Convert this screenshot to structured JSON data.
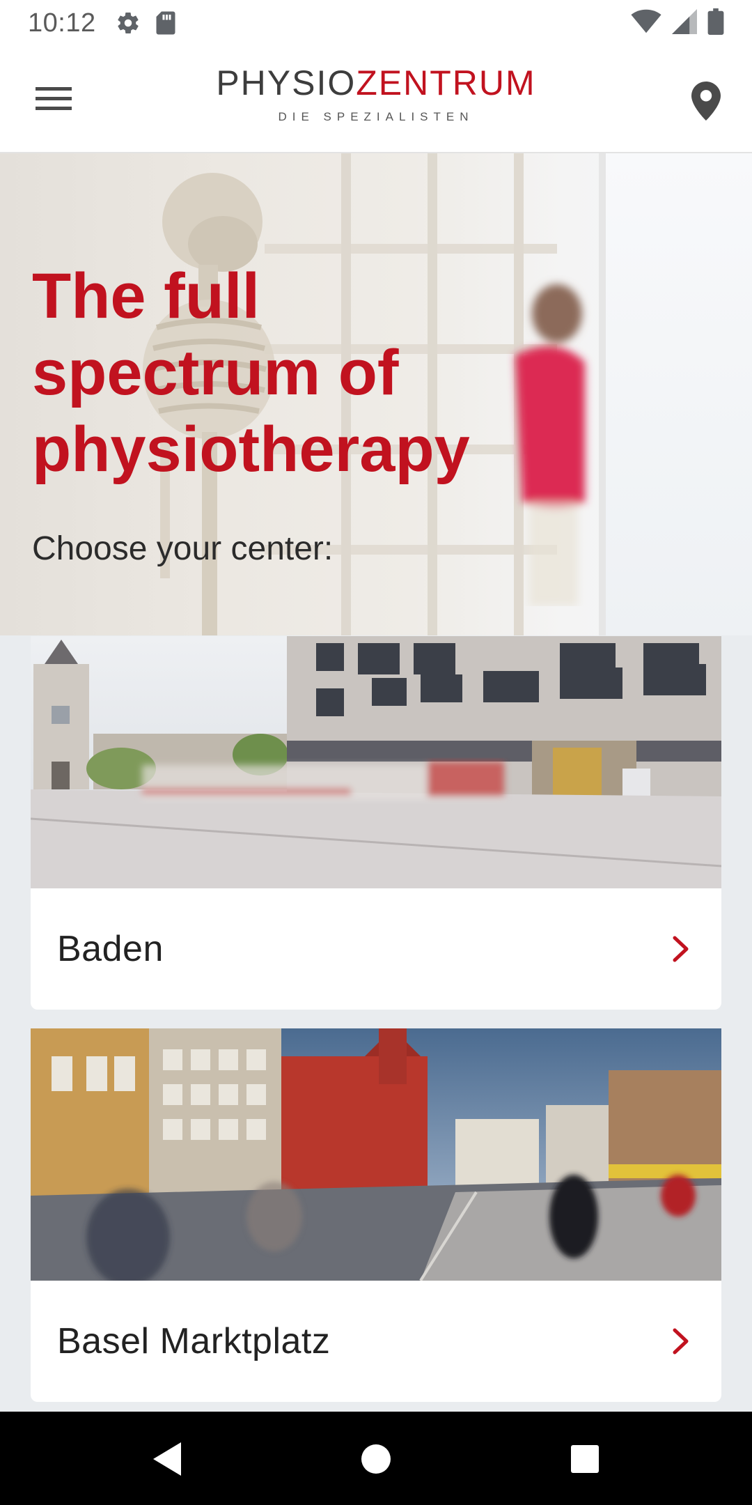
{
  "status_bar": {
    "time": "10:12",
    "left_icons": [
      "gear-icon",
      "sd-card-icon"
    ],
    "right_icons": [
      "wifi-icon",
      "cell-signal-icon",
      "battery-icon"
    ]
  },
  "header": {
    "logo_physio": "PHYSIO",
    "logo_zentrum": "ZENTRUM",
    "logo_tagline": "DIE SPEZIALISTEN",
    "menu_icon": "hamburger-menu-icon",
    "location_icon": "location-pin-icon"
  },
  "hero": {
    "title": "The full spectrum of physiotherapy",
    "subtitle": "Choose your center:"
  },
  "centers": [
    {
      "name": "Baden"
    },
    {
      "name": "Basel Marktplatz"
    }
  ],
  "colors": {
    "brand_red": "#c1121f",
    "text_dark": "#222222",
    "page_bg": "#e9ecef"
  },
  "nav_bar": {
    "icons": [
      "back-triangle-icon",
      "home-circle-icon",
      "recents-square-icon"
    ]
  }
}
